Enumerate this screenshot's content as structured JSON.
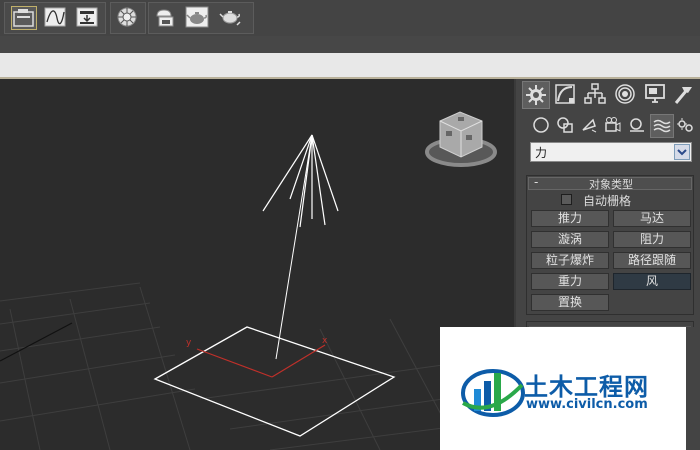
{
  "toolbar": {
    "group1": [
      {
        "name": "scene-explorer-icon"
      },
      {
        "name": "curve-editor-icon"
      },
      {
        "name": "render-setup-icon"
      }
    ],
    "group2": [
      {
        "name": "material-editor-icon"
      }
    ],
    "group3": [
      {
        "name": "render-frame-icon"
      },
      {
        "name": "render-teapot-icon"
      },
      {
        "name": "render-production-icon"
      }
    ]
  },
  "command_panel": {
    "tabs": [
      {
        "name": "create-tab-icon",
        "active": true
      },
      {
        "name": "modify-tab-icon"
      },
      {
        "name": "hierarchy-tab-icon"
      },
      {
        "name": "motion-tab-icon"
      },
      {
        "name": "display-tab-icon"
      },
      {
        "name": "utilities-tab-icon"
      }
    ],
    "subtabs": [
      {
        "name": "geometry-subtab-icon"
      },
      {
        "name": "shapes-subtab-icon"
      },
      {
        "name": "lights-subtab-icon"
      },
      {
        "name": "cameras-subtab-icon"
      },
      {
        "name": "helpers-subtab-icon"
      },
      {
        "name": "space-warps-subtab-icon",
        "active": true
      },
      {
        "name": "systems-subtab-icon"
      }
    ],
    "category_dropdown": {
      "value": "力"
    },
    "object_type_rollout": {
      "toggle": "-",
      "title": "对象类型",
      "autogrid_label": "自动栅格",
      "autogrid_checked": false,
      "buttons": [
        {
          "label": "推力",
          "active": false
        },
        {
          "label": "马达",
          "active": false
        },
        {
          "label": "漩涡",
          "active": false
        },
        {
          "label": "阻力",
          "active": false
        },
        {
          "label": "粒子爆炸",
          "active": false
        },
        {
          "label": "路径跟随",
          "active": false
        },
        {
          "label": "重力",
          "active": false
        },
        {
          "label": "风",
          "active": true
        },
        {
          "label": "置换",
          "active": false
        }
      ]
    }
  },
  "viewport": {
    "gizmo_axis_x": "x",
    "gizmo_axis_y": "y"
  },
  "watermark": {
    "name": "土木工程网",
    "url": "www.civilcn.com"
  }
}
